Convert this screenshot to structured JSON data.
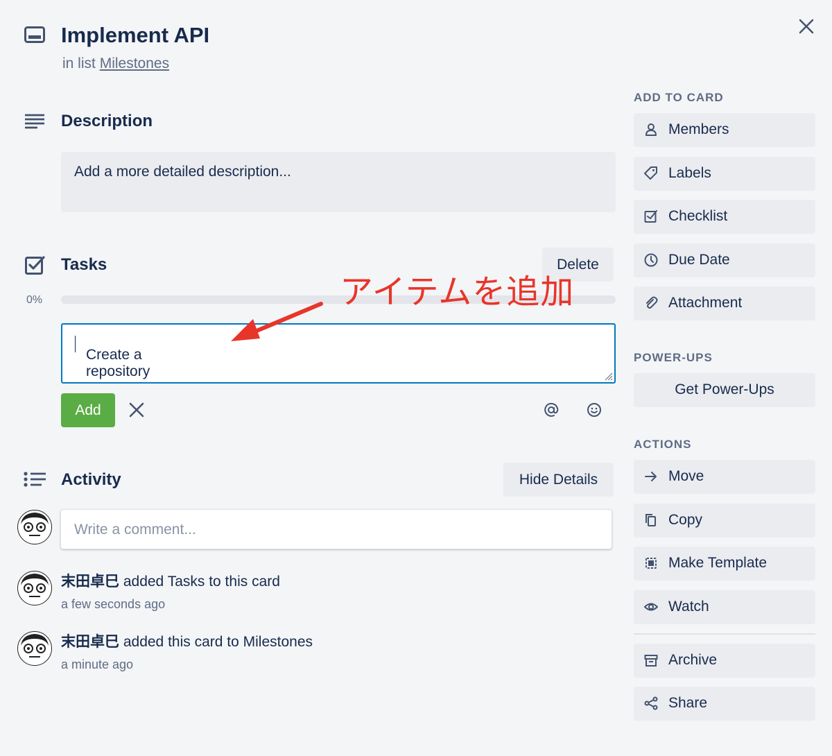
{
  "card": {
    "title": "Implement API",
    "in_list_prefix": "in list",
    "list_name": "Milestones"
  },
  "description": {
    "title": "Description",
    "placeholder": "Add a more detailed description..."
  },
  "tasks": {
    "title": "Tasks",
    "delete_label": "Delete",
    "progress": "0%",
    "progress_fraction": 0,
    "input_value": "Create a repository",
    "add_label": "Add"
  },
  "annotation": {
    "text": "アイテムを追加",
    "color": "#e8352a"
  },
  "activity": {
    "title": "Activity",
    "hide_details_label": "Hide Details",
    "comment_placeholder": "Write a comment...",
    "items": [
      {
        "user": "末田卓巳",
        "action": "added Tasks to this card",
        "time": "a few seconds ago"
      },
      {
        "user": "末田卓巳",
        "action": "added this card to Milestones",
        "time": "a minute ago"
      }
    ]
  },
  "sidebar": {
    "add_to_card": {
      "heading": "ADD TO CARD",
      "items": [
        {
          "label": "Members",
          "icon": "person-icon"
        },
        {
          "label": "Labels",
          "icon": "tag-icon"
        },
        {
          "label": "Checklist",
          "icon": "checkbox-icon"
        },
        {
          "label": "Due Date",
          "icon": "clock-icon"
        },
        {
          "label": "Attachment",
          "icon": "paperclip-icon"
        }
      ]
    },
    "power_ups": {
      "heading": "POWER-UPS",
      "button": "Get Power-Ups"
    },
    "actions": {
      "heading": "ACTIONS",
      "items": [
        {
          "label": "Move",
          "icon": "arrow-right-icon"
        },
        {
          "label": "Copy",
          "icon": "copy-icon"
        },
        {
          "label": "Make Template",
          "icon": "template-icon"
        },
        {
          "label": "Watch",
          "icon": "eye-icon"
        },
        {
          "label": "Archive",
          "icon": "archive-icon"
        },
        {
          "label": "Share",
          "icon": "share-icon"
        }
      ]
    }
  },
  "colors": {
    "accent_blue": "#0079bf",
    "add_green": "#5aac44",
    "background": "#f4f5f7",
    "button_grey": "#ebecf0"
  }
}
